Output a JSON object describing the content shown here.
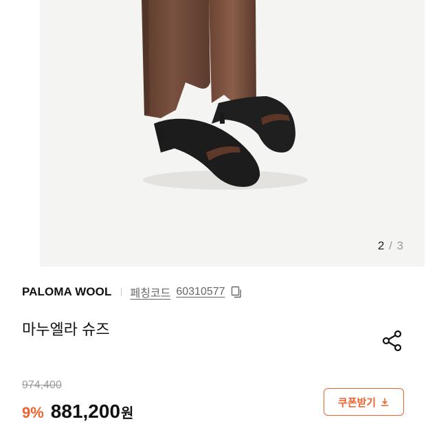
{
  "gallery": {
    "current_page": "2",
    "separator": "/",
    "total_pages": "3",
    "image_description": "product-photo-sandal-with-trousers"
  },
  "product": {
    "brand": "PALOMA WOOL",
    "code_label": "페칭코드",
    "code_value": "60310577",
    "title": "마누엘라 슈즈"
  },
  "pricing": {
    "original_price": "974,400",
    "discount": "9%",
    "price": "881,200",
    "currency": "원"
  },
  "actions": {
    "coupon_label": "쿠폰받기"
  },
  "colors": {
    "accent": "#f0612c",
    "text": "#111111",
    "muted": "#9a9a9a"
  }
}
